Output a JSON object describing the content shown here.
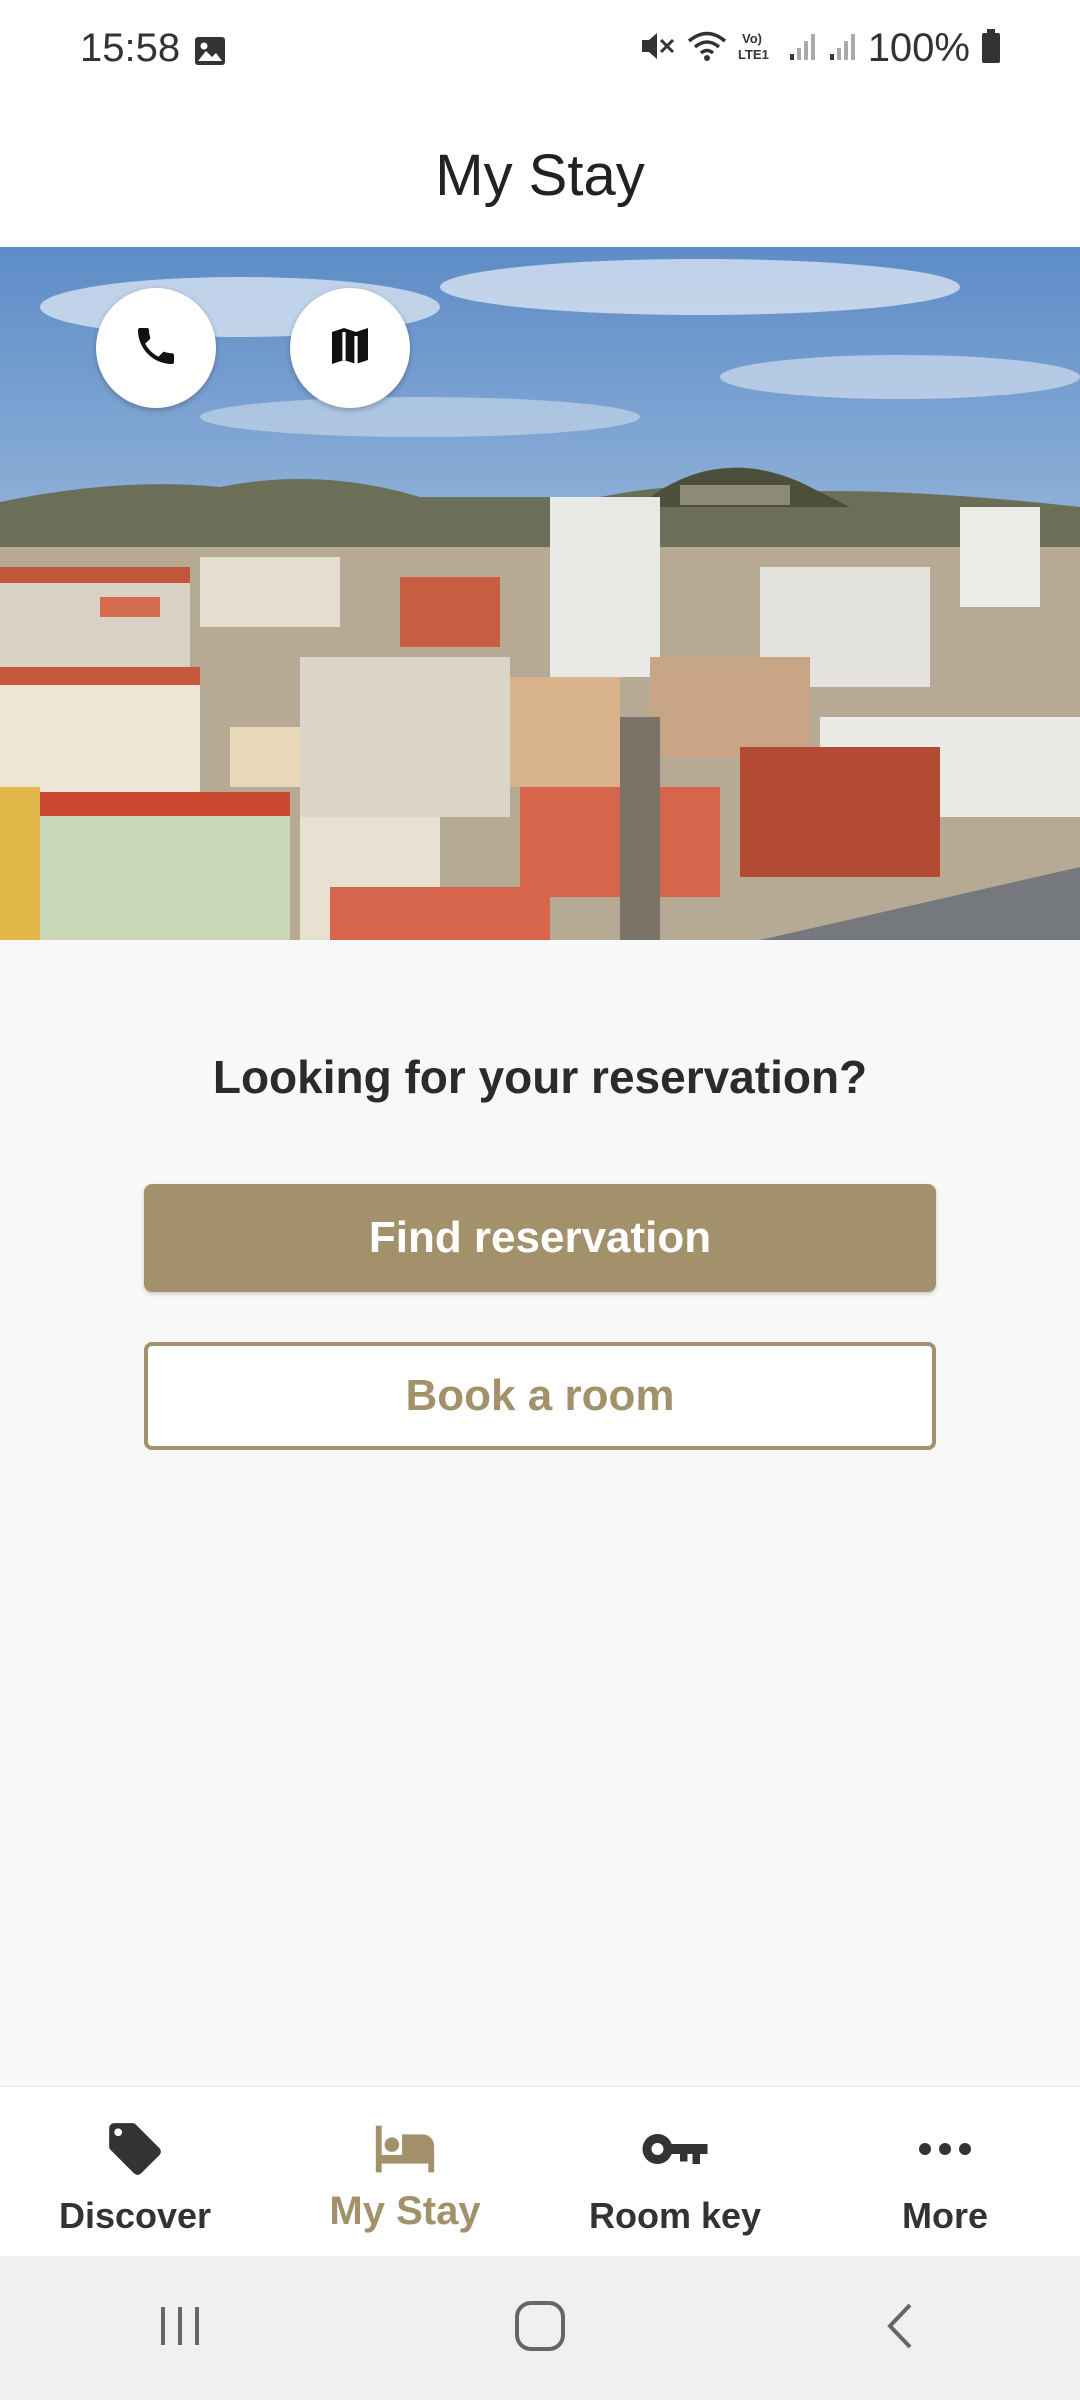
{
  "status_bar": {
    "time": "15:58",
    "battery": "100%",
    "icons": [
      "image-icon",
      "mute-icon",
      "wifi-icon",
      "volte-icon",
      "signal-icon",
      "signal-icon",
      "battery-icon"
    ]
  },
  "header": {
    "title": "My Stay"
  },
  "hero": {
    "image": "city-panorama",
    "actions": [
      {
        "icon": "phone-icon"
      },
      {
        "icon": "map-icon"
      }
    ]
  },
  "main": {
    "question": "Looking for your reservation?",
    "find_label": "Find reservation",
    "book_label": "Book a room"
  },
  "bottom_nav": {
    "items": [
      {
        "label": "Discover",
        "icon": "tag-icon",
        "active": false
      },
      {
        "label": "My Stay",
        "icon": "bed-icon",
        "active": true
      },
      {
        "label": "Room key",
        "icon": "key-icon",
        "active": false
      },
      {
        "label": "More",
        "icon": "more-icon",
        "active": false
      }
    ]
  },
  "system_nav": {
    "icons": [
      "recents-icon",
      "home-icon",
      "back-icon"
    ]
  },
  "colors": {
    "accent": "#a3916b",
    "text_dark": "#2b2b2b",
    "background": "#f8f8f8"
  }
}
